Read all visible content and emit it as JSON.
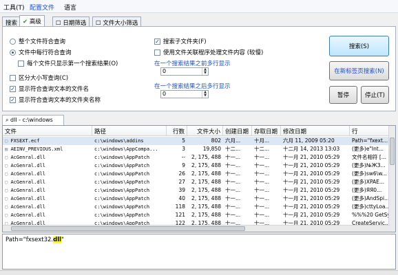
{
  "menu": {
    "tools": "工具(T)",
    "config": "配置文件",
    "language": "语言"
  },
  "tabs": [
    "搜索",
    "高级",
    "日期筛选",
    "文件大小筛选"
  ],
  "options": {
    "whole_file": "整个文件符合查询",
    "per_line": "文件中每行符合查询",
    "first_result_only": "每个文件只显示第一个搜索结果(O)",
    "case_sensitive": "区分大小写查询(C)",
    "show_filename": "显示符合查询文本的文件名",
    "show_foldername": "显示符合查询文本的文件夹名称",
    "search_subfolders": "搜索子文件夹(F)",
    "use_assoc": "使用文件关联程序处理文件内容 (较慢)",
    "lines_before_label": "在一个搜索结果之前多行显示",
    "lines_before_value": "0",
    "lines_after_label": "在一个搜索结果之后多行显示",
    "lines_after_value": "0"
  },
  "buttons": {
    "search": "搜索(S)",
    "new_tab_search": "在新标签页搜索(N)",
    "pause": "暂停",
    "stop": "停止(T)"
  },
  "path_tab": "dll - c:\\windows",
  "columns": [
    "文件",
    "路径",
    "行数",
    "文件大小",
    "创建日期",
    "存取日期",
    "修改日期",
    "行"
  ],
  "rows": [
    [
      "FXSEXT.ecf",
      "c:\\windows\\addins",
      "5",
      "802",
      "六月...",
      "十月...",
      "六月 11, 2009 05:20",
      "Path=\"fxext..."
    ],
    [
      "AEINV_PREVIOUS.xml",
      "c:\\windows\\AppCompa...",
      "3",
      "19,850",
      "十二...",
      "十二...",
      "十二月 14, 2013 13:03",
      "(更多)e\"Int..."
    ],
    [
      "AcGenral.dll",
      "c:\\windows\\AppPatch",
      "--",
      "2, 175, 488",
      "十一...",
      "十一...",
      "十一月 21, 2010 05:29",
      "文件名相符 [..."
    ],
    [
      "AcGenral.dll",
      "c:\\windows\\AppPatch",
      "9",
      "2, 175, 488",
      "十一...",
      "十一...",
      "十一月 21, 2010 05:29",
      "(更多)№ЖЗ..."
    ],
    [
      "AcGenral.dll",
      "c:\\windows\\AppPatch",
      "26",
      "2, 175, 488",
      "十一...",
      "十一...",
      "十一月 21, 2010 05:29",
      "(更多)sw6\\w..."
    ],
    [
      "AcGenral.dll",
      "c:\\windows\\AppPatch",
      "27",
      "2, 175, 488",
      "十一...",
      "十一...",
      "十一月 21, 2010 05:29",
      "(更多)XPAE..."
    ],
    [
      "AcGenral.dll",
      "c:\\windows\\AppPatch",
      "39",
      "2, 175, 488",
      "十一...",
      "十一...",
      "十一月 21, 2010 05:29",
      "(更多)ЯЯ0..."
    ],
    [
      "AcGenral.dll",
      "c:\\windows\\AppPatch",
      "40",
      "2, 175, 488",
      "十一...",
      "十一...",
      "十一月 21, 2010 05:29",
      "(更多)AndSpi..."
    ],
    [
      "AcGenral.dll",
      "c:\\windows\\AppPatch",
      "118",
      "2, 175, 488",
      "十一...",
      "十一...",
      "十一月 21, 2010 05:29",
      "(更多)cttyLoa..."
    ],
    [
      "AcGenral.dll",
      "c:\\windows\\AppPatch",
      "121",
      "2, 175, 488",
      "十一...",
      "十一...",
      "十一月 21, 2010 05:29",
      "%%%20 GetSys..."
    ],
    [
      "AcGenral.dll",
      "c:\\windows\\AppPatch",
      "122",
      "2, 175, 488",
      "十一...",
      "十一...",
      "十一月 21, 2010 05:29",
      "CreateServic..."
    ]
  ],
  "preview": {
    "prefix": "Path=\"fxsext32.",
    "highlight": "dll",
    "suffix": "\""
  }
}
